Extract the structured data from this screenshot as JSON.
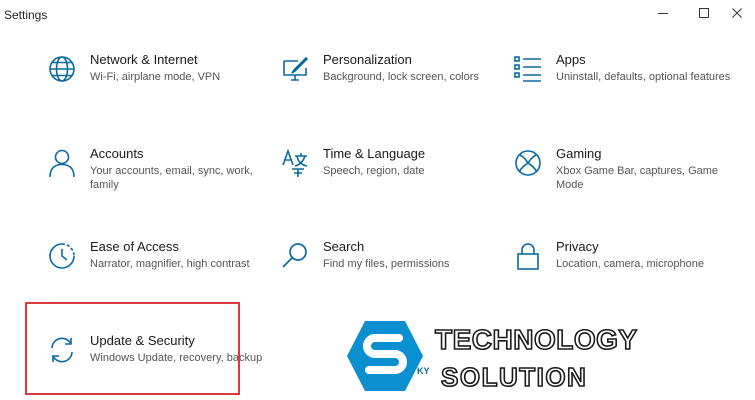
{
  "window": {
    "title": "Settings",
    "accent": "#0a6aa0"
  },
  "tiles": [
    {
      "title": "Network & Internet",
      "desc": "Wi-Fi, airplane mode, VPN",
      "icon": "globe-icon"
    },
    {
      "title": "Personalization",
      "desc": "Background, lock screen, colors",
      "icon": "paint-icon"
    },
    {
      "title": "Apps",
      "desc": "Uninstall, defaults, optional features",
      "icon": "apps-list-icon"
    },
    {
      "title": "Accounts",
      "desc": "Your accounts, email, sync, work, family",
      "icon": "person-icon"
    },
    {
      "title": "Time & Language",
      "desc": "Speech, region, date",
      "icon": "time-language-icon"
    },
    {
      "title": "Gaming",
      "desc": "Xbox Game Bar, captures, Game Mode",
      "icon": "xbox-icon"
    },
    {
      "title": "Ease of Access",
      "desc": "Narrator, magnifier, high contrast",
      "icon": "ease-of-access-icon"
    },
    {
      "title": "Search",
      "desc": "Find my files, permissions",
      "icon": "search-icon"
    },
    {
      "title": "Privacy",
      "desc": "Location, camera, microphone",
      "icon": "lock-icon"
    },
    {
      "title": "Update & Security",
      "desc": "Windows Update, recovery, backup",
      "icon": "sync-icon"
    }
  ],
  "highlight": {
    "color": "#d93a3a"
  },
  "watermark": {
    "line1": "TECHNOLOGY",
    "prefix": "KY",
    "line2": "SOLUTION",
    "color": "#0a8fd0"
  }
}
